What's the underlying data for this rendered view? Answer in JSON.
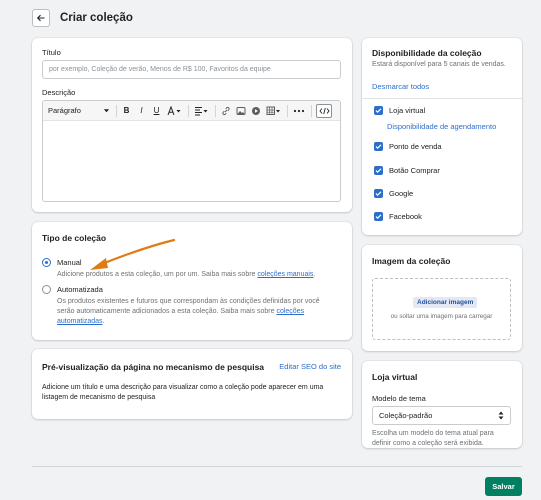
{
  "header": {
    "title": "Criar coleção"
  },
  "title_card": {
    "title_label": "Título",
    "title_placeholder": "por exemplo, Coleção de verão, Menos de R$ 100, Favoritos da equipe",
    "description_label": "Descrição",
    "format_select": "Parágrafo"
  },
  "collection_type": {
    "heading": "Tipo de coleção",
    "options": [
      {
        "label": "Manual",
        "selected": true,
        "description": "Adicione produtos a esta coleção, um por um. Saiba mais sobre ",
        "link": "coleções manuais",
        "suffix": "."
      },
      {
        "label": "Automatizada",
        "selected": false,
        "description_1": "Os produtos existentes e futuros que correspondam às condições definidas por você",
        "description_2": "serão automaticamente adicionados a esta coleção. Saiba mais sobre ",
        "link_1": "coleções",
        "link_2": "automatizadas",
        "suffix": "."
      }
    ]
  },
  "seo": {
    "heading": "Pré-visualização da página no mecanismo de pesquisa",
    "edit_link": "Editar SEO do site",
    "text_1": "Adicione um título e uma descrição para visualizar como a coleção pode aparecer em uma",
    "text_2": "listagem de mecanismo de pesquisa"
  },
  "availability": {
    "heading": "Disponibilidade da coleção",
    "subtext": "Estará disponível para 5 canais de vendas.",
    "deselect_all": "Desmarcar todos",
    "schedule_link": "Disponibilidade de agendamento",
    "channels": [
      {
        "label": "Loja virtual",
        "checked": true
      },
      {
        "label": "Ponto de venda",
        "checked": true
      },
      {
        "label": "Botão Comprar",
        "checked": true
      },
      {
        "label": "Google",
        "checked": true
      },
      {
        "label": "Facebook",
        "checked": true
      }
    ]
  },
  "image": {
    "heading": "Imagem da coleção",
    "add_button": "Adicionar imagem",
    "drop_text": "ou soltar uma imagem para carregar"
  },
  "store": {
    "heading": "Loja virtual",
    "template_label": "Modelo de tema",
    "template_value": "Coleção-padrão",
    "help_1": "Escolha um modelo do tema atual para",
    "help_2": "definir como a coleção será exibida."
  },
  "footer": {
    "save_label": "Salvar"
  },
  "colors": {
    "accent": "#2c6ecb",
    "primary": "#008060",
    "arrow": "#e07b16"
  }
}
